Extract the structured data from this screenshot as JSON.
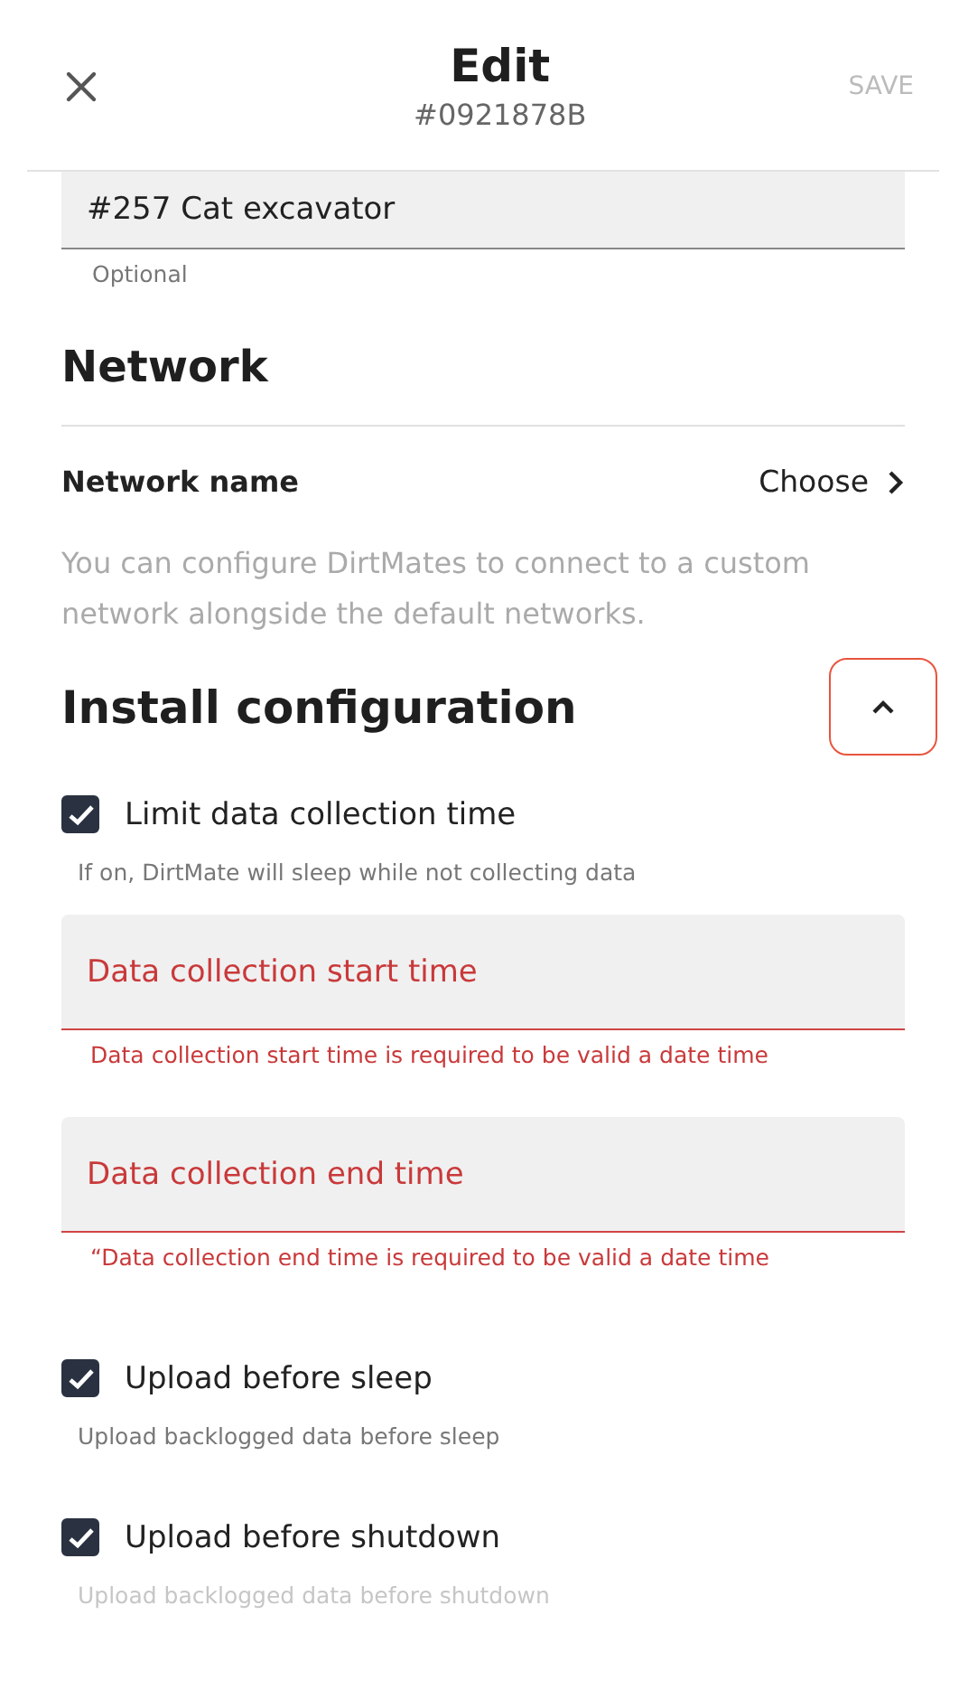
{
  "header": {
    "title": "Edit",
    "subtitle": "#0921878B",
    "save_label": "SAVE",
    "save_disabled": true
  },
  "name_field": {
    "value": "#257 Cat excavator",
    "helper": "Optional"
  },
  "network": {
    "heading": "Network",
    "row_label": "Network name",
    "row_value": "Choose",
    "description": "You can configure DirtMates to connect to a custom network alongside the default networks."
  },
  "install": {
    "heading": "Install configuration",
    "expanded": true,
    "items": [
      {
        "kind": "checkbox",
        "label": "Limit data collection time",
        "checked": true,
        "hint": "If on, DirtMate will sleep while not collecting data",
        "hint_faded": false
      },
      {
        "kind": "field",
        "placeholder": "Data collection start time",
        "error": true,
        "message": "Data collection start time is required to be valid a date time"
      },
      {
        "kind": "field",
        "placeholder": "Data collection end time",
        "error": true,
        "message": "“Data collection end time is required to be valid a date time"
      },
      {
        "kind": "checkbox",
        "label": "Upload before sleep",
        "checked": true,
        "hint": "Upload backlogged data before sleep",
        "hint_faded": false
      },
      {
        "kind": "checkbox",
        "label": "Upload before shutdown",
        "checked": true,
        "hint": "Upload backlogged data before shutdown",
        "hint_faded": true
      }
    ]
  }
}
